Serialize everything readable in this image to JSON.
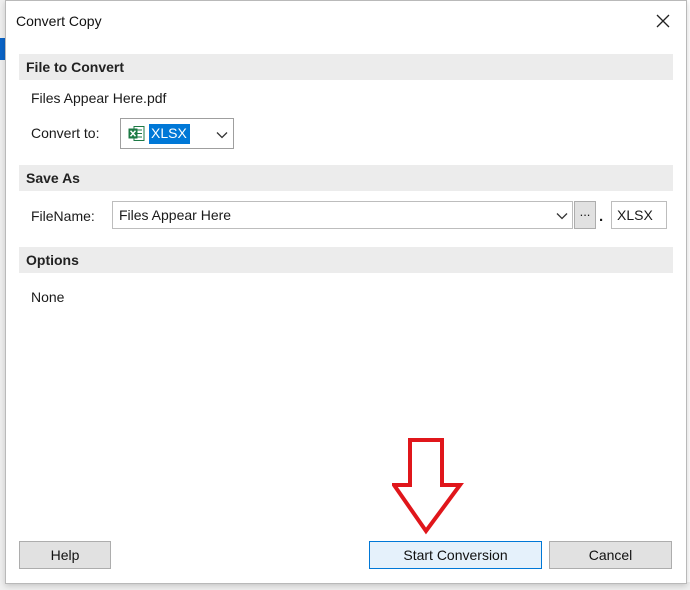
{
  "dialog": {
    "title": "Convert Copy",
    "close_icon": "close-icon"
  },
  "file_section": {
    "header": "File to Convert",
    "filename": "Files Appear Here.pdf",
    "convert_label": "Convert to:",
    "convert_value": "XLSX",
    "convert_icon": "excel-icon"
  },
  "save_section": {
    "header": "Save As",
    "filename_label": "FileName:",
    "filename_value": "Files Appear Here",
    "browse_label": "...",
    "separator": ".",
    "extension": "XLSX"
  },
  "options_section": {
    "header": "Options",
    "value": "None"
  },
  "buttons": {
    "help": "Help",
    "start": "Start Conversion",
    "cancel": "Cancel"
  },
  "annotation": {
    "icon": "down-arrow-icon",
    "color": "#e0161b"
  },
  "colors": {
    "selection": "#0078d7",
    "excel_green": "#1d7a45",
    "section_bg": "#ececec"
  }
}
